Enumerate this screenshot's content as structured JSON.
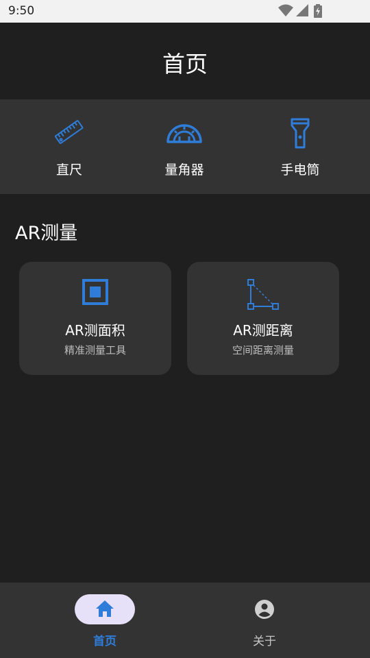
{
  "status_bar": {
    "time": "9:50"
  },
  "app_bar": {
    "title": "首页"
  },
  "tools": [
    {
      "label": "直尺",
      "icon": "ruler-icon"
    },
    {
      "label": "量角器",
      "icon": "protractor-icon"
    },
    {
      "label": "手电筒",
      "icon": "flashlight-icon"
    }
  ],
  "ar_section": {
    "title": "AR测量",
    "cards": [
      {
        "title": "AR测面积",
        "subtitle": "精准测量工具",
        "icon": "area-square-icon"
      },
      {
        "title": "AR测距离",
        "subtitle": "空间距离测量",
        "icon": "distance-triangle-icon"
      }
    ]
  },
  "bottom_nav": {
    "items": [
      {
        "label": "首页",
        "icon": "home-icon",
        "selected": true
      },
      {
        "label": "关于",
        "icon": "account-circle-icon",
        "selected": false
      }
    ]
  },
  "colors": {
    "accent": "#2f7dd8",
    "background": "#1f1f1f",
    "surface": "#333333",
    "nav_pill": "#e6e1f8"
  }
}
